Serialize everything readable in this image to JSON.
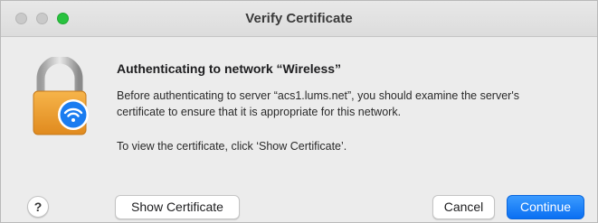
{
  "window": {
    "title": "Verify Certificate"
  },
  "dialog": {
    "heading": "Authenticating to network “Wireless”",
    "message": "Before authenticating to server “acs1.lums.net”, you should examine the server's certificate to ensure that it is appropriate for this network.",
    "instruction": "To view the certificate, click ‘Show Certificate’."
  },
  "buttons": {
    "help": "?",
    "show_certificate": "Show Certificate",
    "cancel": "Cancel",
    "continue": "Continue"
  },
  "icons": {
    "traffic_close": "close-button",
    "traffic_minimize": "minimize-button",
    "traffic_zoom": "zoom-button",
    "dialog_icon": "padlock-wifi-icon"
  },
  "colors": {
    "accent": "#0a6ff2",
    "lock_body": "#f2a43a",
    "wifi_badge": "#1a7cf0"
  }
}
